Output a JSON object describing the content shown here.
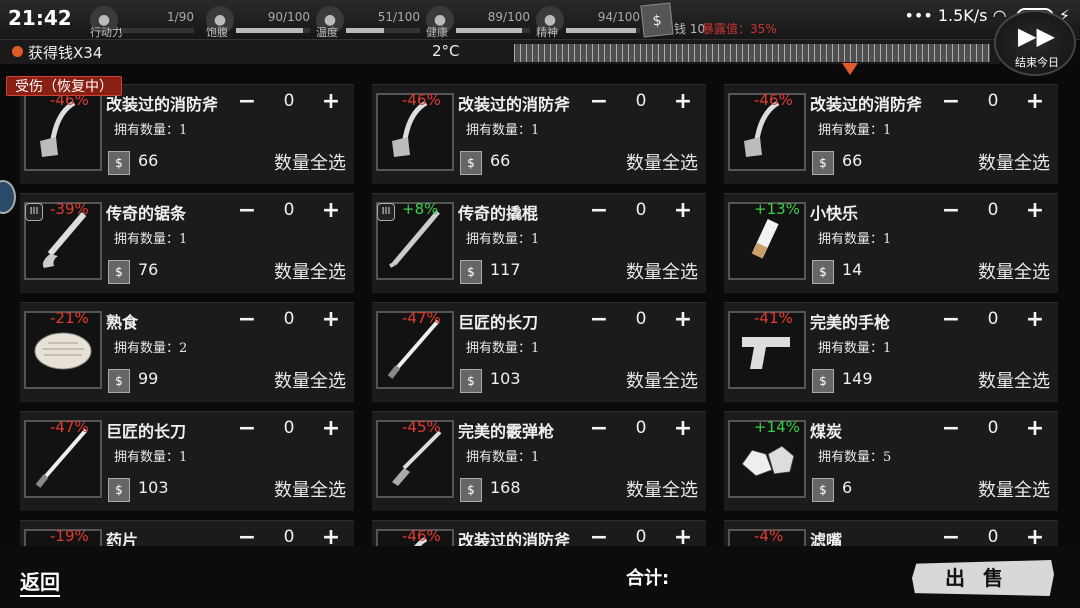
{
  "status_bar": {
    "time": "21:42",
    "network": "1.5K/s",
    "battery": "36"
  },
  "hud": {
    "stats": [
      {
        "label": "行动力",
        "value": "1/90",
        "level": 0.011,
        "icon": "footprint-icon"
      },
      {
        "label": "饱腹",
        "value": "90/100",
        "level": 0.9,
        "icon": "hunger-icon"
      },
      {
        "label": "温度",
        "value": "51/100",
        "level": 0.51,
        "icon": "temperature-icon"
      },
      {
        "label": "健康",
        "value": "89/100",
        "level": 0.89,
        "icon": "health-icon"
      },
      {
        "label": "精神",
        "value": "94/100",
        "level": 0.94,
        "icon": "spirit-icon"
      }
    ],
    "money_label": "钱 10",
    "exposure": "暴露值：35%",
    "gain_text": "获得钱X34",
    "temperature": "2°C",
    "skip_label": "结束今日"
  },
  "status_tag": "受伤（恢复中）",
  "owned_prefix": "拥有数量：",
  "select_all": "数量全选",
  "items": [
    {
      "name": "改装过的消防斧",
      "pct": "-46%",
      "owned": "1",
      "price": "66",
      "qty": "0",
      "icon": "fire-axe-icon",
      "tier": ""
    },
    {
      "name": "改装过的消防斧",
      "pct": "-46%",
      "owned": "1",
      "price": "66",
      "qty": "0",
      "icon": "fire-axe-icon",
      "tier": ""
    },
    {
      "name": "改装过的消防斧",
      "pct": "-46%",
      "owned": "1",
      "price": "66",
      "qty": "0",
      "icon": "fire-axe-icon",
      "tier": ""
    },
    {
      "name": "传奇的锯条",
      "pct": "-39%",
      "owned": "1",
      "price": "76",
      "qty": "0",
      "icon": "saw-blade-icon",
      "tier": "III"
    },
    {
      "name": "传奇的撬棍",
      "pct": "+8%",
      "owned": "1",
      "price": "117",
      "qty": "0",
      "icon": "crowbar-icon",
      "tier": "III"
    },
    {
      "name": "小快乐",
      "pct": "+13%",
      "owned": "1",
      "price": "14",
      "qty": "0",
      "icon": "cigarette-icon",
      "tier": ""
    },
    {
      "name": "熟食",
      "pct": "-21%",
      "owned": "2",
      "price": "99",
      "qty": "0",
      "icon": "cooked-food-icon",
      "tier": ""
    },
    {
      "name": "巨匠的长刀",
      "pct": "-47%",
      "owned": "1",
      "price": "103",
      "qty": "0",
      "icon": "long-knife-icon",
      "tier": ""
    },
    {
      "name": "完美的手枪",
      "pct": "-41%",
      "owned": "1",
      "price": "149",
      "qty": "0",
      "icon": "pistol-icon",
      "tier": ""
    },
    {
      "name": "巨匠的长刀",
      "pct": "-47%",
      "owned": "1",
      "price": "103",
      "qty": "0",
      "icon": "long-knife-icon",
      "tier": ""
    },
    {
      "name": "完美的霰弹枪",
      "pct": "-45%",
      "owned": "1",
      "price": "168",
      "qty": "0",
      "icon": "shotgun-icon",
      "tier": ""
    },
    {
      "name": "煤炭",
      "pct": "+14%",
      "owned": "5",
      "price": "6",
      "qty": "0",
      "icon": "coal-icon",
      "tier": ""
    },
    {
      "name": "药片",
      "pct": "-19%",
      "owned": "",
      "price": "",
      "qty": "0",
      "icon": "pills-icon",
      "tier": ""
    },
    {
      "name": "改装过的消防斧",
      "pct": "-46%",
      "owned": "",
      "price": "",
      "qty": "0",
      "icon": "fire-axe-icon",
      "tier": ""
    },
    {
      "name": "滤嘴",
      "pct": "-4%",
      "owned": "",
      "price": "",
      "qty": "0",
      "icon": "filter-icon",
      "tier": ""
    }
  ],
  "footer": {
    "back": "返回",
    "total_label": "合计:",
    "sell": "出售"
  }
}
